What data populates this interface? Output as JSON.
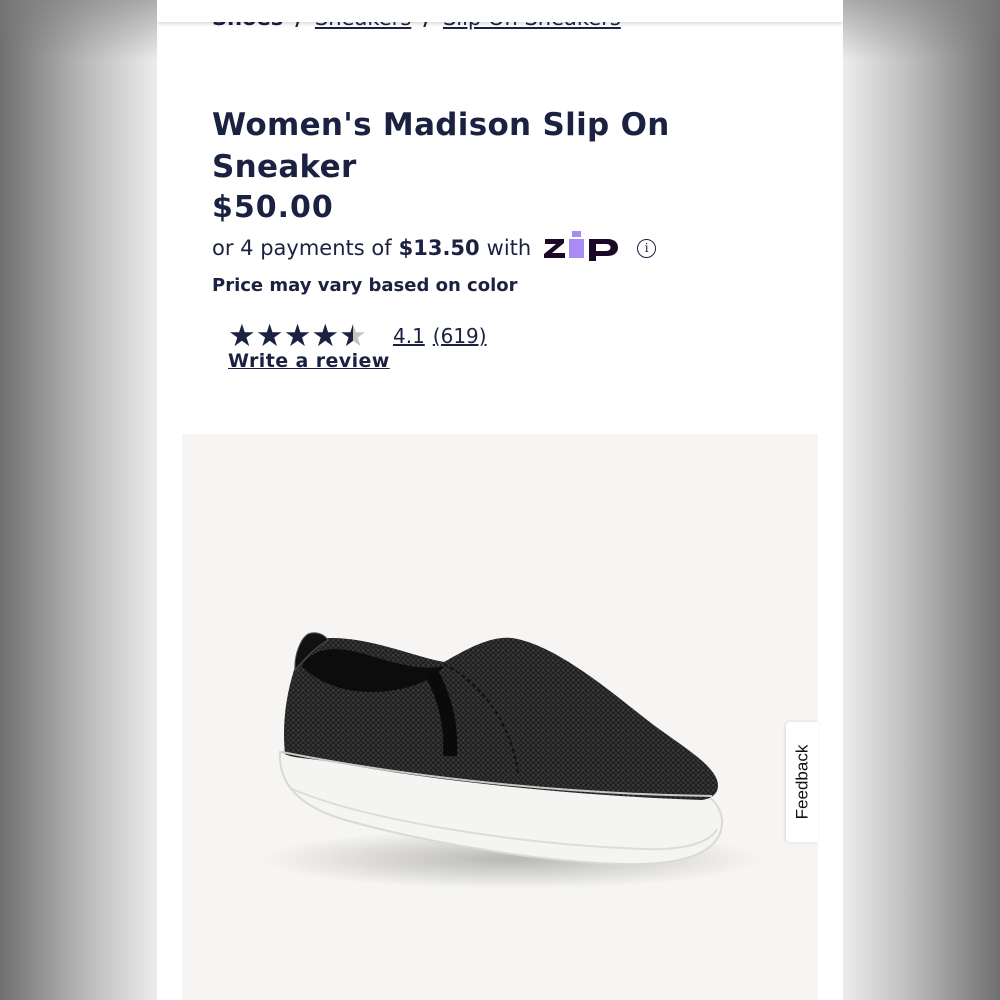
{
  "breadcrumb": {
    "items": [
      "Shoes",
      "Sneakers",
      "Slip On Sneakers"
    ],
    "separator": "/"
  },
  "product": {
    "title": "Women's Madison Slip On Sneaker",
    "price": "$50.00",
    "installments": {
      "prefix": "or 4 payments of",
      "amount": "$13.50",
      "suffix": "with",
      "provider": "ZIP",
      "info_icon": "info-circle-icon"
    },
    "price_note": "Price may vary based on color",
    "image_alt": "Black slip-on sneaker with white sole"
  },
  "rating": {
    "score": "4.1",
    "count": "(619)",
    "stars_value": 4.1,
    "stars_max": 5,
    "write_review_label": "Write a review"
  },
  "feedback": {
    "label": "Feedback"
  },
  "colors": {
    "navy": "#1b2140",
    "zip_purple": "#a98bf5",
    "zip_dark": "#1a0826",
    "image_bg": "#f6f5f3",
    "star_empty": "#c4c4c4"
  }
}
